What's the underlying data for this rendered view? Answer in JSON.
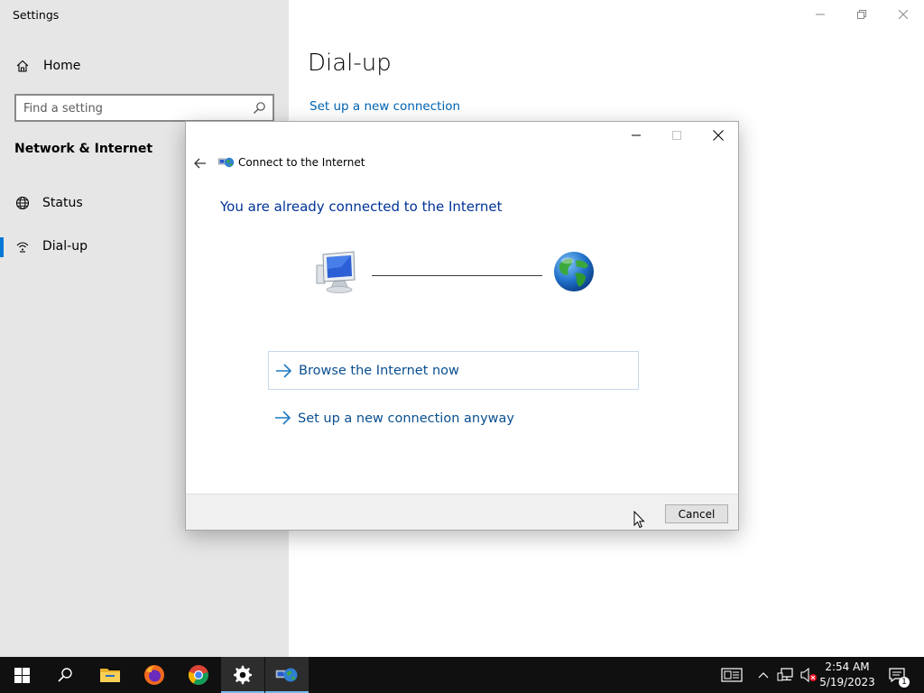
{
  "settings": {
    "app_title": "Settings",
    "nav": {
      "home_label": "Home",
      "search_placeholder": "Find a setting",
      "section_heading": "Network & Internet",
      "items": [
        {
          "label": "Status",
          "icon": "globe-outline-icon"
        },
        {
          "label": "Dial-up",
          "icon": "dialup-icon",
          "selected": true
        }
      ]
    },
    "page_title": "Dial-up",
    "setup_link": "Set up a new connection",
    "accent_color": "#0078d7"
  },
  "dialog": {
    "title": "Connect to the Internet",
    "heading": "You are already connected to the Internet",
    "commands": [
      {
        "label": "Browse the Internet now"
      },
      {
        "label": "Set up a new connection anyway"
      }
    ],
    "cancel_label": "Cancel",
    "heading_color": "#003399",
    "link_color": "#0a4f8f"
  },
  "taskbar": {
    "pinned": [
      "windows-start-icon",
      "search-icon",
      "file-explorer-icon",
      "firefox-icon",
      "chrome-icon",
      "settings-gear-icon",
      "connect-to-internet-icon"
    ],
    "time": "2:54 AM",
    "date": "5/19/2023",
    "notification_count": "1"
  }
}
